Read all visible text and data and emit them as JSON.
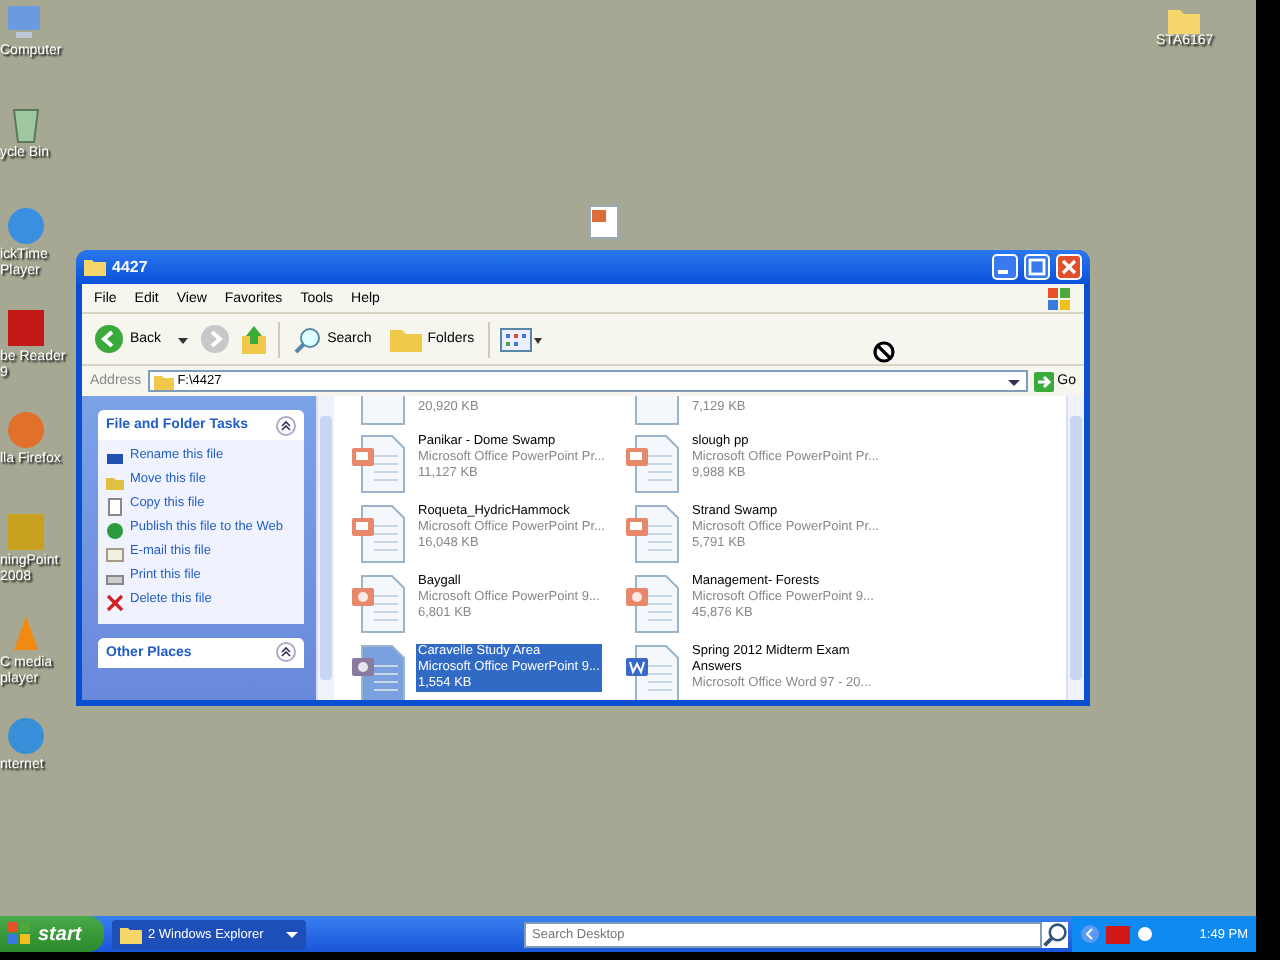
{
  "desktop_icons": [
    {
      "label": "Computer",
      "kind": "computer"
    },
    {
      "label": "ycle Bin",
      "kind": "bin"
    },
    {
      "label": "ickTime Player",
      "kind": "quicktime"
    },
    {
      "label": "be Reader 9",
      "kind": "pdf"
    },
    {
      "label": "lla Firefox",
      "kind": "firefox"
    },
    {
      "label": "ningPoint 2008",
      "kind": "turning"
    },
    {
      "label": "C media player",
      "kind": "vlc"
    },
    {
      "label": "nternet",
      "kind": "ie"
    }
  ],
  "desktop_folder": {
    "label": "STA6167"
  },
  "window": {
    "title": "4427",
    "menu": [
      "File",
      "Edit",
      "View",
      "Favorites",
      "Tools",
      "Help"
    ],
    "toolbar": {
      "back": "Back",
      "search": "Search",
      "folders": "Folders"
    },
    "address": {
      "label": "Address",
      "value": "F:\\4427",
      "go": "Go"
    },
    "tasks": {
      "title": "File and Folder Tasks",
      "items": [
        {
          "label": "Rename this file",
          "kind": "rename"
        },
        {
          "label": "Move this file",
          "kind": "move"
        },
        {
          "label": "Copy this file",
          "kind": "copy"
        },
        {
          "label": "Publish this file to the Web",
          "kind": "publish"
        },
        {
          "label": "E-mail this file",
          "kind": "email"
        },
        {
          "label": "Print this file",
          "kind": "print"
        },
        {
          "label": "Delete this file",
          "kind": "delete"
        }
      ]
    },
    "other_places": {
      "title": "Other Places"
    },
    "files": [
      {
        "kind": "clipped",
        "size": "20,920 KB",
        "selected": false
      },
      {
        "kind": "clipped",
        "size": "7,129 KB",
        "selected": false
      },
      {
        "kind": "pptx",
        "name": "Panikar - Dome Swamp",
        "type": "Microsoft Office PowerPoint Pr...",
        "size": "11,127 KB",
        "selected": false
      },
      {
        "kind": "pptx",
        "name": "slough pp",
        "type": "Microsoft Office PowerPoint Pr...",
        "size": "9,988 KB",
        "selected": false
      },
      {
        "kind": "pptx",
        "name": "Roqueta_HydricHammock",
        "type": "Microsoft Office PowerPoint Pr...",
        "size": "16,048 KB",
        "selected": false
      },
      {
        "kind": "pptx",
        "name": "Strand Swamp",
        "type": "Microsoft Office PowerPoint Pr...",
        "size": "5,791 KB",
        "selected": false
      },
      {
        "kind": "ppt",
        "name": "Baygall",
        "type": "Microsoft Office PowerPoint 9...",
        "size": "6,801 KB",
        "selected": false
      },
      {
        "kind": "ppt",
        "name": "Management- Forests",
        "type": "Microsoft Office PowerPoint 9...",
        "size": "45,876 KB",
        "selected": false
      },
      {
        "kind": "ppt",
        "name": "Caravelle Study Area",
        "type": "Microsoft Office PowerPoint 9...",
        "size": "1,554 KB",
        "selected": true
      },
      {
        "kind": "doc",
        "name": "Spring 2012 Midterm Exam Answers",
        "type": "Microsoft Office Word 97 - 20...",
        "selected": false
      }
    ]
  },
  "taskbar": {
    "start": "start",
    "task": "2 Windows Explorer",
    "search_placeholder": "Search Desktop",
    "clock": "1:49 PM"
  }
}
